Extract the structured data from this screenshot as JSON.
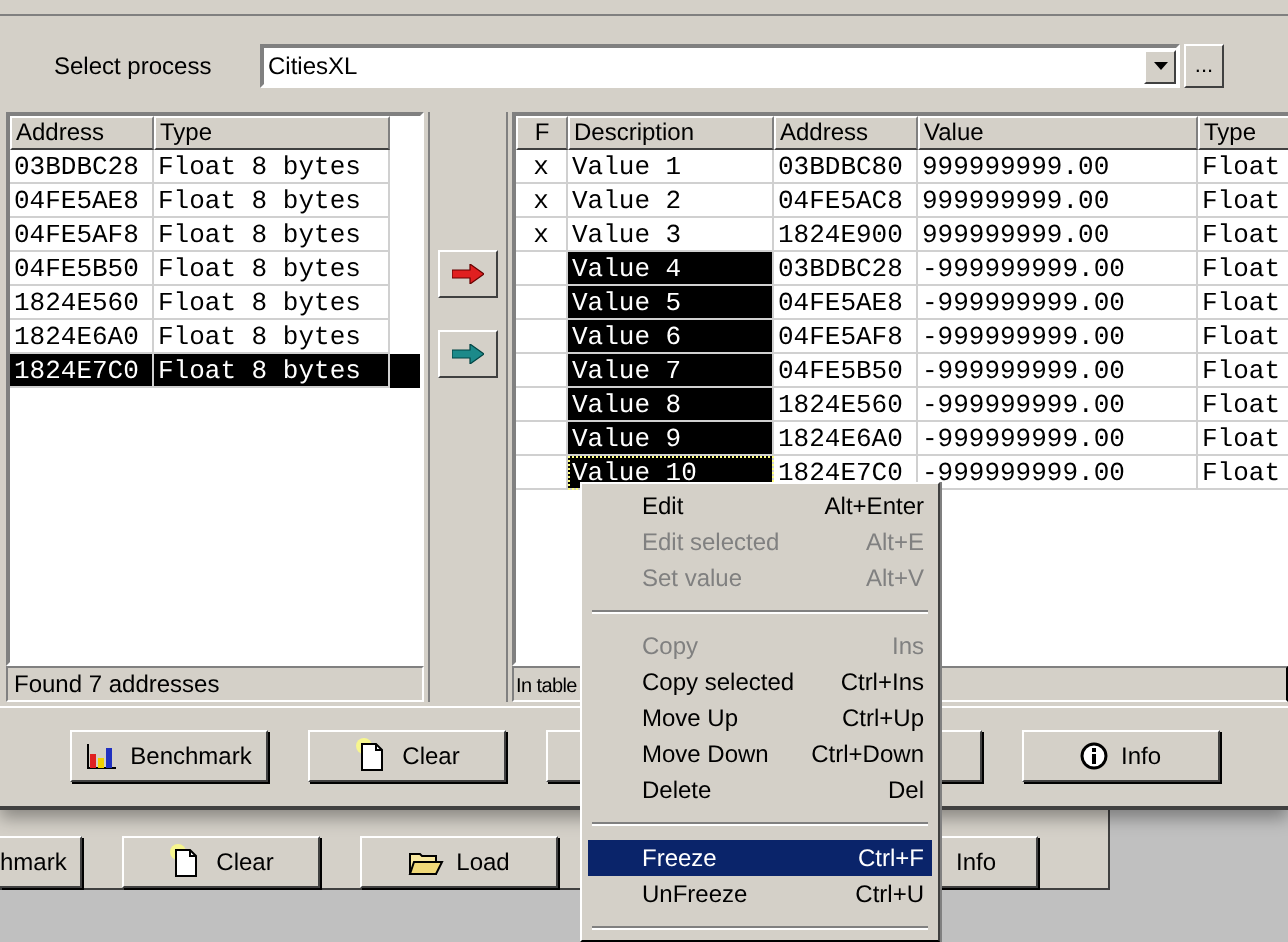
{
  "process": {
    "label": "Select process",
    "value": "CitiesXL",
    "browse": "..."
  },
  "left_table": {
    "columns": [
      "Address",
      "Type"
    ],
    "rows": [
      {
        "address": "03BDBC28",
        "type": "Float 8 bytes",
        "selected": false
      },
      {
        "address": "04FE5AE8",
        "type": "Float 8 bytes",
        "selected": false
      },
      {
        "address": "04FE5AF8",
        "type": "Float 8 bytes",
        "selected": false
      },
      {
        "address": "04FE5B50",
        "type": "Float 8 bytes",
        "selected": false
      },
      {
        "address": "1824E560",
        "type": "Float 8 bytes",
        "selected": false
      },
      {
        "address": "1824E6A0",
        "type": "Float 8 bytes",
        "selected": false
      },
      {
        "address": "1824E7C0",
        "type": "Float 8 bytes",
        "selected": true
      }
    ],
    "status": "Found 7 addresses"
  },
  "right_table": {
    "columns": [
      "F",
      "Description",
      "Address",
      "Value",
      "Type"
    ],
    "rows": [
      {
        "flag": "x",
        "description": "Value 1",
        "address": "03BDBC80",
        "value": "999999999.00",
        "type": "Float",
        "selected": false,
        "focused": false
      },
      {
        "flag": "x",
        "description": "Value 2",
        "address": "04FE5AC8",
        "value": "999999999.00",
        "type": "Float",
        "selected": false,
        "focused": false
      },
      {
        "flag": "x",
        "description": "Value 3",
        "address": "1824E900",
        "value": "999999999.00",
        "type": "Float",
        "selected": false,
        "focused": false
      },
      {
        "description": "Value 4",
        "address": "03BDBC28",
        "value": "-999999999.00",
        "type": "Float",
        "selected": true,
        "focused": false
      },
      {
        "description": "Value 5",
        "address": "04FE5AE8",
        "value": "-999999999.00",
        "type": "Float",
        "selected": true,
        "focused": false
      },
      {
        "description": "Value 6",
        "address": "04FE5AF8",
        "value": "-999999999.00",
        "type": "Float",
        "selected": true,
        "focused": false
      },
      {
        "description": "Value 7",
        "address": "04FE5B50",
        "value": "-999999999.00",
        "type": "Float",
        "selected": true,
        "focused": false
      },
      {
        "description": "Value 8",
        "address": "1824E560",
        "value": "-999999999.00",
        "type": "Float",
        "selected": true,
        "focused": false
      },
      {
        "description": "Value 9",
        "address": "1824E6A0",
        "value": "-999999999.00",
        "type": "Float",
        "selected": true,
        "focused": false
      },
      {
        "description": "Value 10",
        "address": "1824E7C0",
        "value": "-999999999.00",
        "type": "Float",
        "selected": true,
        "focused": true
      }
    ],
    "status": "In table"
  },
  "buttons": [
    {
      "kind": "button",
      "label": "Benchmark"
    },
    {
      "kind": "button",
      "label": "Clear"
    },
    {
      "kind": "covered"
    },
    {
      "kind": "covered"
    },
    {
      "kind": "button",
      "label": "Info"
    }
  ],
  "back_buttons": [
    {
      "kind": "button",
      "label": "hmark"
    },
    {
      "kind": "button",
      "label": "Clear"
    },
    {
      "kind": "button",
      "label": "Load"
    },
    {
      "kind": "button",
      "label": "Info"
    }
  ],
  "context_menu": {
    "items": [
      {
        "kind": "item",
        "label": "Edit",
        "shortcut": "Alt+Enter",
        "disabled": false,
        "selected": false
      },
      {
        "kind": "item",
        "label": "Edit selected",
        "shortcut": "Alt+E",
        "disabled": true,
        "selected": false
      },
      {
        "kind": "item",
        "label": "Set value",
        "shortcut": "Alt+V",
        "disabled": true,
        "selected": false
      },
      {
        "kind": "separator"
      },
      {
        "kind": "item",
        "label": "Copy",
        "shortcut": "Ins",
        "disabled": true,
        "selected": false
      },
      {
        "kind": "item",
        "label": "Copy selected",
        "shortcut": "Ctrl+Ins",
        "disabled": false,
        "selected": false
      },
      {
        "kind": "item",
        "label": "Move Up",
        "shortcut": "Ctrl+Up",
        "disabled": false,
        "selected": false
      },
      {
        "kind": "item",
        "label": "Move Down",
        "shortcut": "Ctrl+Down",
        "disabled": false,
        "selected": false
      },
      {
        "kind": "item",
        "label": "Delete",
        "shortcut": "Del",
        "disabled": false,
        "selected": false
      },
      {
        "kind": "separator"
      },
      {
        "kind": "item",
        "label": "Freeze",
        "shortcut": "Ctrl+F",
        "disabled": false,
        "selected": true
      },
      {
        "kind": "item",
        "label": "UnFreeze",
        "shortcut": "Ctrl+U",
        "disabled": false,
        "selected": false
      },
      {
        "kind": "separator"
      }
    ]
  }
}
